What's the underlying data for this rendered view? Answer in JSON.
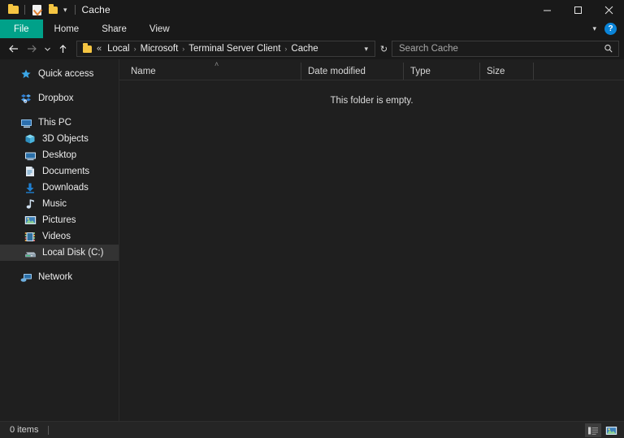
{
  "window": {
    "title": "Cache",
    "quick_access": [
      {
        "name": "folder-icon",
        "label": "Folder"
      },
      {
        "name": "properties-icon",
        "label": "Properties"
      },
      {
        "name": "new-folder-icon",
        "label": "New folder"
      }
    ],
    "customize_label": "Customize Quick Access Toolbar",
    "controls": {
      "minimize": "Minimize",
      "maximize": "Maximize",
      "close": "Close"
    }
  },
  "ribbon": {
    "tabs": [
      {
        "label": "File",
        "active": true
      },
      {
        "label": "Home",
        "active": false
      },
      {
        "label": "Share",
        "active": false
      },
      {
        "label": "View",
        "active": false
      }
    ],
    "expand_label": "Expand the Ribbon",
    "help_label": "?"
  },
  "addressbar": {
    "back_label": "Back",
    "forward_label": "Forward",
    "recent_label": "Recent locations",
    "up_label": "Up to Terminal Server Client",
    "overflow": "«",
    "breadcrumbs": [
      "Local",
      "Microsoft",
      "Terminal Server Client",
      "Cache"
    ],
    "separator": "›",
    "dropdown_label": "Previous locations",
    "refresh_label": "Refresh",
    "refresh_glyph": "↻"
  },
  "search": {
    "placeholder": "Search Cache",
    "icon": "search-icon"
  },
  "sidebar": {
    "items": [
      {
        "label": "Quick access",
        "icon": "star-icon",
        "indent": false,
        "selected": false,
        "gap": false
      },
      {
        "label": "Dropbox",
        "icon": "dropbox-icon",
        "indent": false,
        "selected": false,
        "gap": true
      },
      {
        "label": "This PC",
        "icon": "monitor-icon",
        "indent": false,
        "selected": false,
        "gap": true
      },
      {
        "label": "3D Objects",
        "icon": "cube-icon",
        "indent": true,
        "selected": false,
        "gap": false
      },
      {
        "label": "Desktop",
        "icon": "desktop-icon",
        "indent": true,
        "selected": false,
        "gap": false
      },
      {
        "label": "Documents",
        "icon": "document-icon",
        "indent": true,
        "selected": false,
        "gap": false
      },
      {
        "label": "Downloads",
        "icon": "download-icon",
        "indent": true,
        "selected": false,
        "gap": false
      },
      {
        "label": "Music",
        "icon": "music-icon",
        "indent": true,
        "selected": false,
        "gap": false
      },
      {
        "label": "Pictures",
        "icon": "picture-icon",
        "indent": true,
        "selected": false,
        "gap": false
      },
      {
        "label": "Videos",
        "icon": "video-icon",
        "indent": true,
        "selected": false,
        "gap": false
      },
      {
        "label": "Local Disk (C:)",
        "icon": "drive-icon",
        "indent": true,
        "selected": true,
        "gap": false
      },
      {
        "label": "Network",
        "icon": "network-icon",
        "indent": false,
        "selected": false,
        "gap": true
      }
    ]
  },
  "filelist": {
    "columns": [
      {
        "label": "Name",
        "sorted": true,
        "sort_dir": "ascending"
      },
      {
        "label": "Date modified",
        "sorted": false,
        "sort_dir": ""
      },
      {
        "label": "Type",
        "sorted": false,
        "sort_dir": ""
      },
      {
        "label": "Size",
        "sorted": false,
        "sort_dir": ""
      }
    ],
    "sort_caret": "˄",
    "rows": [],
    "empty_message": "This folder is empty."
  },
  "statusbar": {
    "item_count": "0 items",
    "views": [
      {
        "name": "details-view",
        "label": "Details view",
        "active": true
      },
      {
        "name": "large-icons-view",
        "label": "Large icons view",
        "active": false
      }
    ]
  },
  "colors": {
    "accent_file_tab": "#00a189",
    "window_bg": "#1f1f1f",
    "titlebar_bg": "#191919",
    "statusbar_bg": "#252525",
    "selection_bg": "#333333",
    "folder_yellow": "#f5c542",
    "help_blue": "#0a84d8"
  }
}
